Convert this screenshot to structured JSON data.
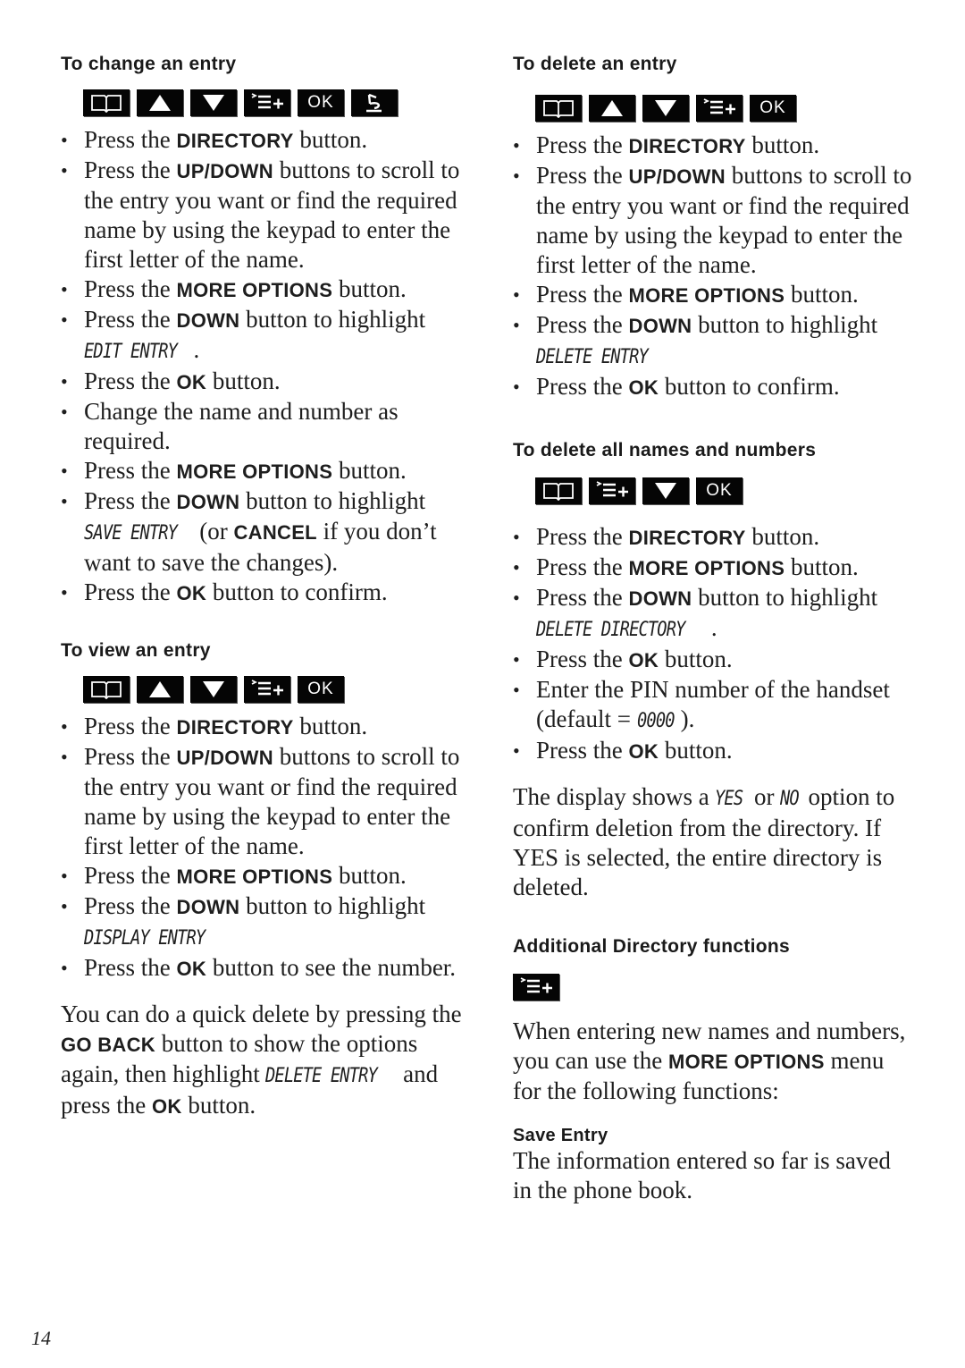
{
  "page_number": "14",
  "icons": {
    "directory": "book-icon",
    "up": "up-arrow-icon",
    "down": "down-arrow-icon",
    "more_options": "more-options-icon",
    "ok": "OK",
    "go_back": "go-back-icon"
  },
  "change_entry": {
    "title": "To change an entry",
    "steps": [
      {
        "pre": "Press the ",
        "bold": "DIRECTORY",
        "post": " button."
      },
      {
        "pre": "Press the ",
        "bold": "UP/DOWN",
        "post": " buttons to scroll to the entry you want or find the required name by using the keypad to enter the first letter of the name."
      },
      {
        "pre": "Press the ",
        "bold": "MORE OPTIONS",
        "post": " button."
      },
      {
        "pre": "Press the ",
        "bold": "DOWN",
        "post": " button to highlight ",
        "lcd": "EDIT ENTRY",
        "tail": "."
      },
      {
        "pre": "Press the ",
        "bold": "OK",
        "post": " button."
      },
      {
        "pre": "Change the name and number as required."
      },
      {
        "pre": "Press the ",
        "bold": "MORE OPTIONS",
        "post": " button."
      },
      {
        "pre": "Press the ",
        "bold": "DOWN",
        "post": " button to highlight ",
        "lcd": "SAVE ENTRY",
        "tail": " (or ",
        "bold2": "CANCEL",
        "tail2": " if you don’t want to save the changes)."
      },
      {
        "pre": "Press the ",
        "bold": "OK",
        "post": " button to confirm."
      }
    ]
  },
  "view_entry": {
    "title": "To view an entry",
    "steps": [
      {
        "pre": "Press the ",
        "bold": "DIRECTORY",
        "post": " button."
      },
      {
        "pre": "Press the ",
        "bold": "UP/DOWN",
        "post": " buttons to scroll to the entry you want or find the required name by using the keypad to enter the first letter of the name."
      },
      {
        "pre": "Press the ",
        "bold": "MORE OPTIONS",
        "post": " button."
      },
      {
        "pre": "Press the ",
        "bold": "DOWN",
        "post": " button to highlight ",
        "lcd": "DISPLAY ENTRY"
      },
      {
        "pre": "Press the ",
        "bold": "OK",
        "post": " button to see the number."
      }
    ],
    "note": {
      "a": "You can do a quick delete by pressing the ",
      "b1": "GO BACK",
      "c": " button to show the options again, then highlight ",
      "lcd": "DELETE ENTRY",
      "d": " and press the ",
      "b2": "OK",
      "e": "  button."
    }
  },
  "delete_entry": {
    "title": "To delete an entry",
    "steps": [
      {
        "pre": "Press the ",
        "bold": "DIRECTORY",
        "post": " button."
      },
      {
        "pre": "Press the ",
        "bold": "UP/DOWN",
        "post": " buttons to scroll to the entry you want or find the required name by using the keypad to enter the first letter of the name."
      },
      {
        "pre": "Press the ",
        "bold": "MORE OPTIONS",
        "post": " button."
      },
      {
        "pre": "Press the ",
        "bold": "DOWN",
        "post": " button to highlight ",
        "lcd": "DELETE ENTRY"
      },
      {
        "pre": "Press the ",
        "bold": "OK",
        "post": " button to confirm."
      }
    ]
  },
  "delete_all": {
    "title": "To delete all names and numbers",
    "steps": [
      {
        "pre": "Press the ",
        "bold": "DIRECTORY",
        "post": " button."
      },
      {
        "pre": "Press the ",
        "bold": "MORE OPTIONS",
        "post": " button."
      },
      {
        "pre": "Press the ",
        "bold": "DOWN",
        "post": " button to highlight ",
        "lcd": "DELETE DIRECTORY",
        "tail": "."
      },
      {
        "pre": "Press the ",
        "bold": "OK",
        "post": " button."
      },
      {
        "pre": "Enter the PIN number of the handset (default = ",
        "lcd": "0000",
        "tail": ")."
      },
      {
        "pre": "Press the ",
        "bold": "OK",
        "post": " button."
      }
    ],
    "note": {
      "a": "The display shows a ",
      "lcd1": "YES",
      "b": " or ",
      "lcd2": "NO",
      "c": " option to confirm deletion from the directory. If YES is selected, the entire directory is deleted."
    }
  },
  "additional": {
    "title": "Additional Directory functions",
    "intro": {
      "a": "When entering new names and numbers, you can use the ",
      "bold": "MORE OPTIONS",
      "b": " menu for the following functions:"
    },
    "save_entry_title": "Save Entry",
    "save_entry_text": "The information entered so far is saved in the phone book."
  }
}
